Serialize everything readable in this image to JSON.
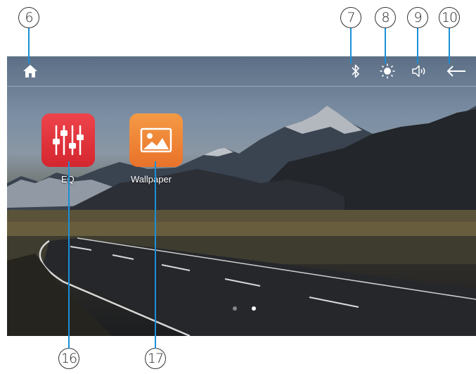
{
  "callouts": {
    "home": "6",
    "bluetooth": "7",
    "brightness": "8",
    "volume": "9",
    "back": "10",
    "eq": "16",
    "wallpaper": "17"
  },
  "apps": {
    "eq": {
      "label": "EQ",
      "icon": "equalizer-icon",
      "color": "#e8343c"
    },
    "wallpaper": {
      "label": "Wallpaper",
      "icon": "image-icon",
      "color": "#f0812f"
    }
  },
  "top_bar": {
    "icons": [
      "home-icon",
      "bluetooth-icon",
      "brightness-icon",
      "volume-icon",
      "back-arrow-icon"
    ]
  },
  "pager": {
    "pages": 2,
    "current": 2
  },
  "colors": {
    "leader": "#1a8fd8",
    "icon": "#ffffff"
  }
}
